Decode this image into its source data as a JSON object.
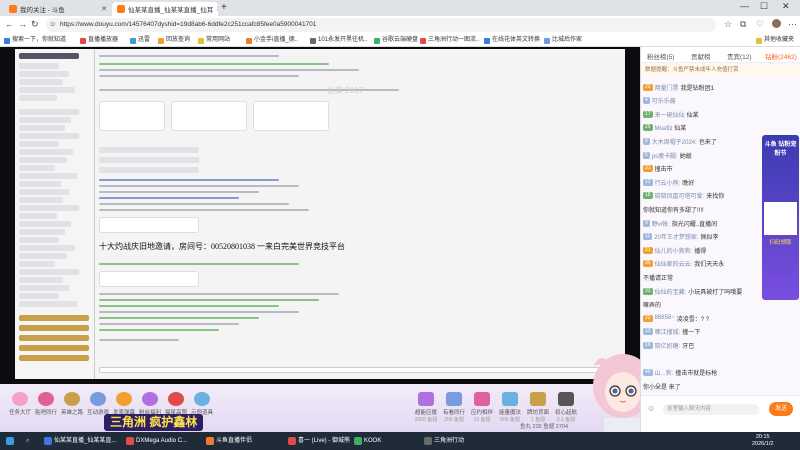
{
  "browser": {
    "tabs": [
      {
        "title": "我的关注 - 斗鱼",
        "active": false
      },
      {
        "title": "仙某某直播_仙某某直播_仙耳",
        "active": true
      }
    ],
    "new_tab": "+",
    "url": "https://www.douyu.com/14576407dyshid=19d8ab6-6ddfe2c251ccafc85fee0a5900041701",
    "bookmarks": [
      "搜索一下，你就知道",
      "直播播放器",
      "迅雷",
      "回放查询",
      "常用网站",
      "小金手i直播_德..",
      "101永发开黑往机..",
      "谷歌云端硬盘",
      "三角洲行动一图流..",
      "在线花体英文转换",
      "比城后作家",
      "其他收藏夹"
    ],
    "controls": {
      "minimize": "—",
      "maximize": "☐",
      "close": "✕",
      "back": "←",
      "forward": "→",
      "reload": "↻"
    }
  },
  "stream": {
    "announcement": "十大灼战庆旧地邀请，房间号：00520801038 一来白完美世界竞技平台",
    "watermark": "仙某 2017",
    "gifts": [
      {
        "name": "任务大厅"
      },
      {
        "name": "贴吧同行"
      },
      {
        "name": "英雄之路"
      },
      {
        "name": "互动游戏"
      },
      {
        "name": "发表弹幕"
      },
      {
        "name": "粉丝福利"
      },
      {
        "name": "福星高照"
      },
      {
        "name": "示例道具"
      }
    ],
    "right_gifts": [
      {
        "name": "超能应援",
        "sub": "2000 鱼翅"
      },
      {
        "name": "有看同行",
        "sub": "200 鱼翅"
      },
      {
        "name": "应约相伴",
        "sub": "10 鱼翅"
      },
      {
        "name": "能量魔法",
        "sub": "500 鱼翅"
      },
      {
        "name": "牌坊背面",
        "sub": "1 鱼翅"
      },
      {
        "name": "初心起航",
        "sub": "0.1 鱼翅"
      }
    ],
    "banner": "三角洲 疯护鑫林",
    "fish_stats": "鱼丸 235    鱼翅 2704"
  },
  "panel": {
    "tabs": [
      "粉丝榜(5)",
      "贡献榜",
      "贵宾(12)",
      "钻粉(2462)"
    ],
    "notice": "数据提醒：斗鱼严禁未成年人充值打赏",
    "messages": [
      {
        "lv": "22",
        "color": "#f0a030",
        "nick": "两量门票",
        "text": "我是钻粉团1"
      },
      {
        "lv": "4",
        "color": "#9fb8e0",
        "nick": "可乐乐酱",
        "text": ""
      },
      {
        "lv": "17",
        "color": "#70b070",
        "nick": "来一碗仙仙",
        "text": "仙某"
      },
      {
        "lv": "25",
        "color": "#70b070",
        "nick": "Mua仙",
        "text": "仙某"
      },
      {
        "lv": "8",
        "color": "#9fb8e0",
        "nick": "大木周帽子2024:",
        "text": "也来了"
      },
      {
        "lv": "5",
        "color": "#9fb8e0",
        "nick": "ps瘦卡腿:",
        "text": "她敲"
      },
      {
        "lv": "31",
        "color": "#f0a030",
        "nick": "",
        "text": "撞击市"
      },
      {
        "lv": "12",
        "color": "#9fb8e0",
        "nick": "行云小熊:",
        "text": "晚好"
      },
      {
        "lv": "18",
        "color": "#70b070",
        "nick": "晓晓凤凰可塔可爱:",
        "text": "来找你"
      },
      {
        "lv": "",
        "color": "#9fb8e0",
        "nick": "",
        "text": "你就知道你有多甜了!!!!"
      },
      {
        "lv": "9",
        "color": "#9fb8e0",
        "nick": "野vi帐:",
        "text": "指光闪耀..直播间"
      },
      {
        "lv": "11",
        "color": "#9fb8e0",
        "nick": "20年王才梦想家:",
        "text": "佩似李"
      },
      {
        "lv": "21",
        "color": "#f0a030",
        "nick": "仙儿的小狗狗:",
        "text": "播得"
      },
      {
        "lv": "30",
        "color": "#f0a030",
        "nick": "仙仙家的云云:",
        "text": "我们天天永"
      },
      {
        "lv": "",
        "color": "#9fb8e0",
        "nick": "",
        "text": "不播请正常"
      },
      {
        "lv": "33",
        "color": "#70b070",
        "nick": "仙仙的宝藏:",
        "text": "小玩具被打了吗哦要"
      },
      {
        "lv": "",
        "color": "#9fb8e0",
        "nick": "",
        "text": "嘛弄的"
      },
      {
        "lv": "22",
        "color": "#f0a030",
        "nick": "88858~",
        "text": "凌凌雪：? ?"
      },
      {
        "lv": "13",
        "color": "#9fb8e0",
        "nick": "哪江撞城:",
        "text": "撞一下"
      },
      {
        "lv": "16",
        "color": "#9fb8e0",
        "nick": "晓亿奶糖:",
        "text": "牙巴"
      },
      {
        "lv": "",
        "color": "#9fb8e0",
        "nick": "",
        "text": ""
      },
      {
        "lv": "40",
        "color": "#9fb8e0",
        "nick": "山...狗:",
        "text": "撞击市就是标枪"
      },
      {
        "lv": "",
        "color": "#9fb8e0",
        "nick": "",
        "text": "你小朵是 来了"
      }
    ],
    "ad": {
      "title": "斗鱼 钻粉宠粉节",
      "sub": "扫码领取"
    },
    "input_placeholder": "这里输入聊天内容",
    "send": "发送"
  },
  "taskbar": {
    "items": [
      "仙某某直播_仙某某直...",
      "DXMega Audio C...",
      "斗鱼直播伴侣",
      "喜一 (Live) - 御城熊",
      "KOOK",
      "三角洲行动"
    ],
    "time": "20:15",
    "date": "2026/1/2"
  }
}
